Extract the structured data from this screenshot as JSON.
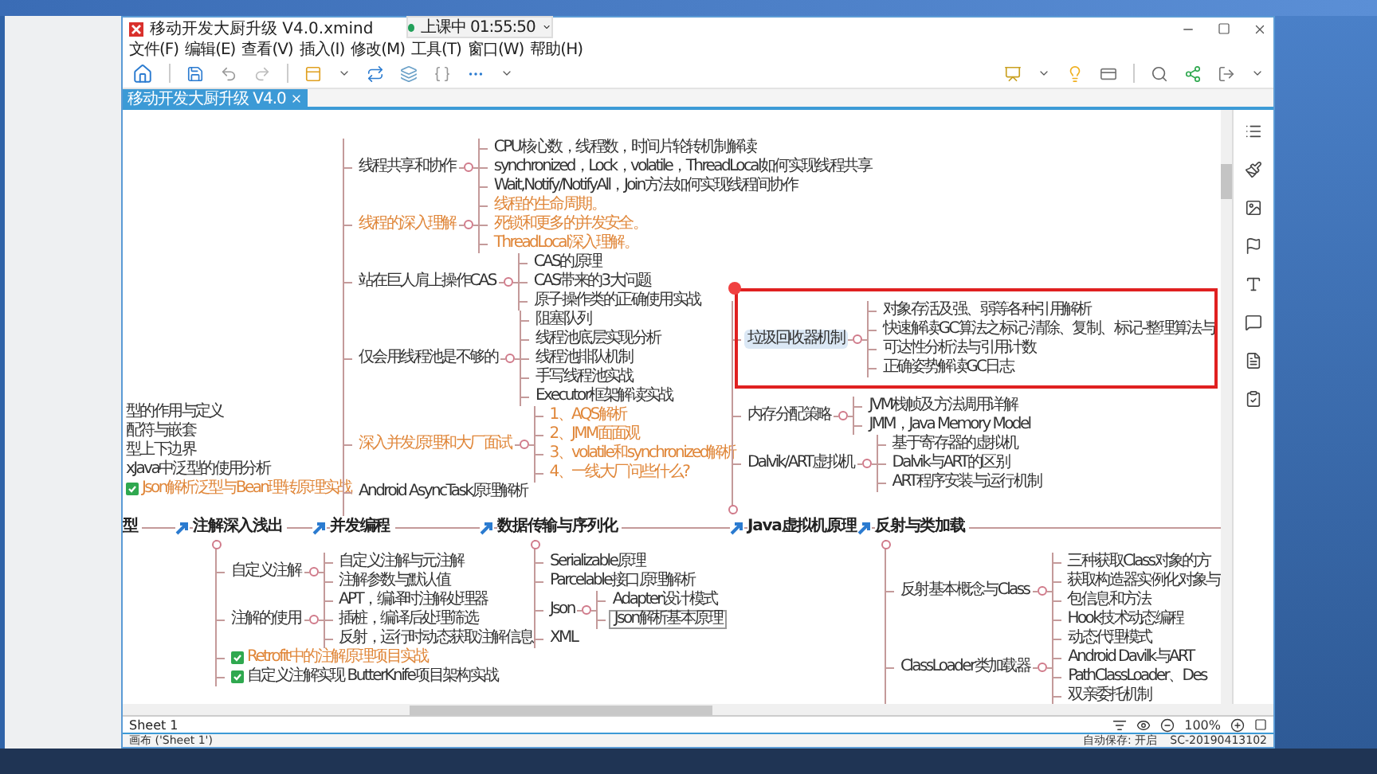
{
  "window": {
    "title": "移动开发大厨升级 V4.0.xmind"
  },
  "recording": {
    "status": "上课中 01:55:50"
  },
  "menu": [
    "文件(F)",
    "编辑(E)",
    "查看(V)",
    "插入(I)",
    "修改(M)",
    "工具(T)",
    "窗口(W)",
    "帮助(H)"
  ],
  "document_tab": {
    "label": "移动开发大厨升级 V4.0"
  },
  "mindmap": {
    "topics": [
      {
        "title": "型",
        "children": [
          {
            "text": "型的作用与定义",
            "kind": "plain"
          },
          {
            "text": "配符与嵌套",
            "kind": "plain"
          },
          {
            "text": "型上下边界",
            "kind": "plain"
          },
          {
            "text": "xJava中泛型的使用分析",
            "kind": "plain"
          },
          {
            "text": "Json解析泛型与Bean理转原理实战",
            "kind": "task",
            "color": "#e0873a"
          }
        ]
      },
      {
        "title": "注解深入浅出",
        "children": [
          {
            "text": "自定义注解",
            "kind": "plain",
            "children": [
              {
                "text": "自定义注解与元注解"
              },
              {
                "text": "注解参数与默认值"
              }
            ]
          },
          {
            "text": "注解的使用",
            "kind": "plain",
            "children": [
              {
                "text": "APT，编译时注解处理器"
              },
              {
                "text": "插桩，编译后处理筛选"
              },
              {
                "text": "反射，运行时动态获取注解信息"
              }
            ]
          },
          {
            "text": "Retrofit中的注解原理项目实战",
            "kind": "task",
            "color": "#e0873a"
          },
          {
            "text": "自定义注解实现 ButterKnife项目架构实战",
            "kind": "task"
          }
        ]
      },
      {
        "title": "并发编程",
        "children": [
          {
            "text": "线程共享和协作",
            "children": [
              {
                "text": "CPU核心数，线程数，时间片轮转机制解读"
              },
              {
                "text": "synchronized，Lock，volatile，ThreadLocal如何实现线程共享"
              },
              {
                "text": "Wait,Notify/NotifyAll，Join方法如何实现线程间协作"
              }
            ]
          },
          {
            "text": "线程的深入理解",
            "color": "#e0873a",
            "children": [
              {
                "text": "线程的生命周期。",
                "color": "#e0873a"
              },
              {
                "text": "死锁和更多的并发安全。",
                "color": "#e0873a"
              },
              {
                "text": "ThreadLocal深入理解。",
                "color": "#e0873a"
              }
            ]
          },
          {
            "text": "站在巨人肩上操作CAS",
            "children": [
              {
                "text": "CAS的原理"
              },
              {
                "text": "CAS带来的3大问题"
              },
              {
                "text": "原子操作类的正确使用实战"
              }
            ]
          },
          {
            "text": "仅会用线程池是不够的",
            "children": [
              {
                "text": "阻塞队列"
              },
              {
                "text": "线程池底层实现分析"
              },
              {
                "text": "线程池排队机制"
              },
              {
                "text": "手写线程池实战"
              },
              {
                "text": "Executor框架解读实战"
              }
            ]
          },
          {
            "text": "深入并发原理和大厂面试",
            "color": "#e0873a",
            "children": [
              {
                "text": "1、AQS解析",
                "color": "#e0873a"
              },
              {
                "text": "2、JMM面面观",
                "color": "#e0873a"
              },
              {
                "text": "3、volatile和synchronized解析",
                "color": "#e0873a"
              },
              {
                "text": "4、一线大厂问些什么?",
                "color": "#e0873a"
              }
            ]
          },
          {
            "text": "Android AsyncTask原理解析"
          }
        ]
      },
      {
        "title": "数据传输与序列化",
        "children": [
          {
            "text": "Serializable原理"
          },
          {
            "text": "Parcelable接口原理解析"
          },
          {
            "text": "Json",
            "children": [
              {
                "text": "Adapter设计模式",
                "kind": "plain"
              },
              {
                "text": "Json解析基本原理",
                "kind": "boxed"
              }
            ]
          },
          {
            "text": "XML"
          }
        ]
      },
      {
        "title": "Java虚拟机原理",
        "children": [
          {
            "text": "垃圾回收器机制",
            "selected": true,
            "children": [
              {
                "text": "对象存活及强、弱等各种引用解析"
              },
              {
                "text": "快速解读GC算法之标记-清除、复制、标记-整理算法与"
              },
              {
                "text": "可达性分析法与引用计数"
              },
              {
                "text": "正确姿势解读GC日志"
              }
            ]
          },
          {
            "text": "内存分配策略",
            "selected": false,
            "children": [
              {
                "text": "JVM栈帧及方法调用详解"
              },
              {
                "text": "JMM，Java Memory Model"
              }
            ]
          },
          {
            "text": "Dalvik/ART虚拟机",
            "selected": false,
            "children": [
              {
                "text": "基于寄存器的虚拟机"
              },
              {
                "text": "Dalvik与ART的区别"
              },
              {
                "text": "ART程序安装与运行机制"
              }
            ]
          }
        ]
      },
      {
        "title": "反射与类加载",
        "children": [
          {
            "text": "反射基本概念与Class",
            "children": [
              {
                "text": "三种获取Class对象的方"
              },
              {
                "text": "获取构造器实例化对象与"
              },
              {
                "text": "包信息和方法"
              },
              {
                "text": "Hook技术动态编程"
              }
            ]
          },
          {
            "text": "ClassLoader类加载器",
            "children": [
              {
                "text": "动态代理模式"
              },
              {
                "text": "Android Davilk与ART"
              },
              {
                "text": "PathClassLoader、Des"
              },
              {
                "text": "双亲委托机制"
              }
            ]
          }
        ]
      }
    ]
  },
  "sheet_tab": {
    "label": "Sheet 1"
  },
  "zoom": {
    "value": "100%"
  },
  "status_bar": {
    "canvas": "画布 ('Sheet 1')",
    "autosave": "自动保存: 开启",
    "machine": "SC-20190413102"
  }
}
